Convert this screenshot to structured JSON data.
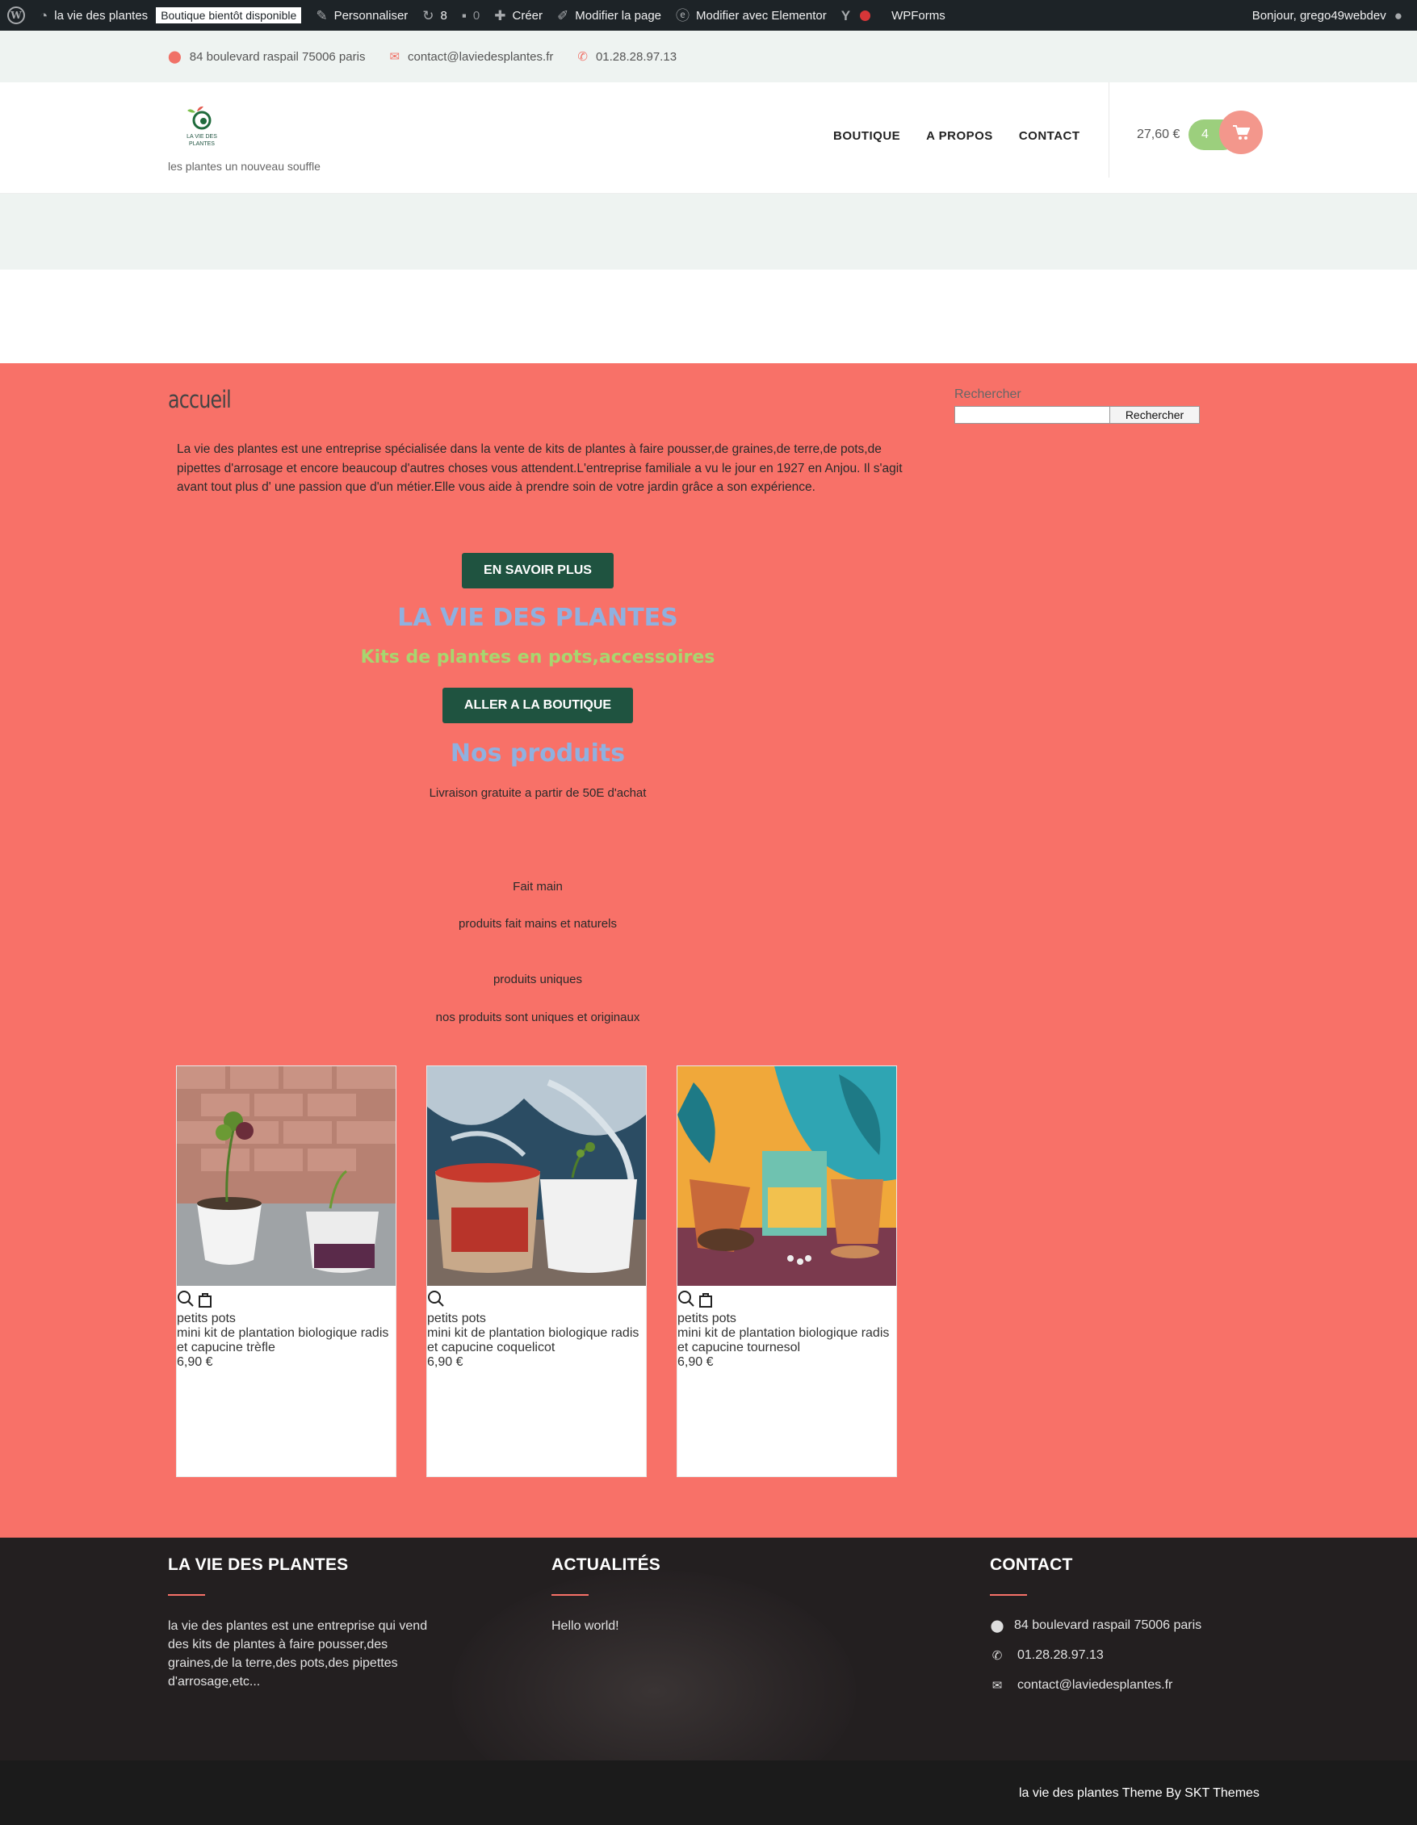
{
  "admin_bar": {
    "site_name": "la vie des plantes",
    "coming_soon_badge": "Boutique bientôt disponible",
    "customize": "Personnaliser",
    "updates_count": "8",
    "comments_count": "0",
    "create": "Créer",
    "edit_page": "Modifier la page",
    "edit_elementor": "Modifier avec Elementor",
    "wpforms": "WPForms",
    "greeting": "Bonjour, grego49webdev"
  },
  "topbar": {
    "address": "84 boulevard raspail 75006 paris",
    "email": "contact@laviedesplantes.fr",
    "phone": "01.28.28.97.13"
  },
  "header": {
    "logo_text_line1": "LA VIE DES",
    "logo_text_line2": "PLANTES",
    "tagline": "les plantes un nouveau souffle",
    "nav": [
      "BOUTIQUE",
      "A PROPOS",
      "CONTACT"
    ],
    "cart_total": "27,60 €",
    "cart_count": "4"
  },
  "main": {
    "page_title": "accueil",
    "intro": "La vie des plantes est une entreprise spécialisée dans la vente  de kits de plantes à faire pousser,de graines,de terre,de pots,de pipettes d'arrosage et encore beaucoup d'autres choses vous attendent.L'entreprise familiale  a vu le jour en 1927 en Anjou. Il s'agit avant  tout plus d' une passion que d'un métier.Elle  vous aide à prendre soin de votre jardin grâce a son expérience.",
    "learn_more_button": "EN SAVOIR PLUS",
    "brand_heading": "LA VIE DES PLANTES",
    "subheading": "Kits de plantes en pots,accessoires",
    "shop_button": "ALLER A LA BOUTIQUE",
    "products_heading": "Nos produits",
    "free_shipping": "Livraison gratuite a partir de 50E d'achat",
    "feature1_title": "Fait main",
    "feature1_text": "produits fait mains et naturels",
    "feature2_title": "produits uniques",
    "feature2_text": "nos produits sont uniques et originaux"
  },
  "sidebar": {
    "search_label": "Rechercher",
    "search_value": "",
    "search_button": "Rechercher"
  },
  "products": [
    {
      "category": "petits pots",
      "name": "mini kit de plantation biologique radis et capucine trèfle",
      "price": "6,90 €"
    },
    {
      "category": "petits pots",
      "name": "mini kit de plantation biologique radis et capucine coquelicot",
      "price": "6,90 €"
    },
    {
      "category": "petits pots",
      "name": "mini kit de plantation biologique radis et capucine tournesol",
      "price": "6,90 €"
    }
  ],
  "footer": {
    "about_title": "LA VIE DES PLANTES",
    "about_text": "la vie des plantes est une entreprise qui vend des kits de plantes à faire pousser,des graines,de la terre,des pots,des pipettes d'arrosage,etc...",
    "news_title": "ACTUALITÉS",
    "news_link": "Hello world!",
    "contact_title": "CONTACT",
    "contact_address": "84 boulevard raspail 75006 paris",
    "contact_phone": "01.28.28.97.13",
    "contact_email": "contact@laviedesplantes.fr",
    "copyright": "la vie des plantes Theme By SKT Themes"
  },
  "colors": {
    "accent_coral": "#f87168",
    "dark_green_button": "#1f5340",
    "heading_blue": "#8fb1e0",
    "heading_green": "#a8d66f",
    "cart_green": "#9ccf7d",
    "cart_pink": "#f3978c"
  }
}
